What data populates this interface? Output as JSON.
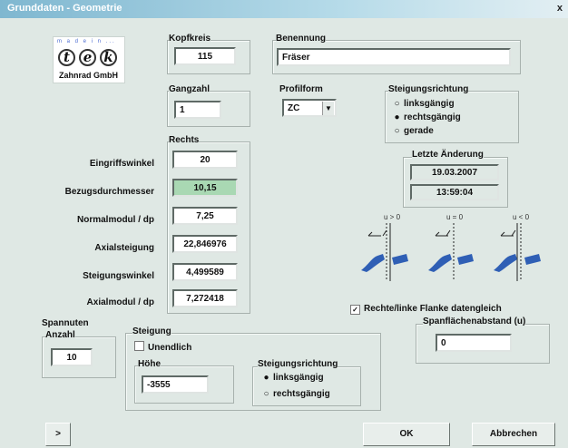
{
  "window": {
    "title": "Grunddaten - Geometrie",
    "close": "x"
  },
  "logo": {
    "top_text": "m a d e i n ...",
    "letters": [
      "t",
      "e",
      "k"
    ],
    "subtitle": "Zahnrad GmbH"
  },
  "kopfkreis": {
    "label": "Kopfkreis",
    "value": "115"
  },
  "benennung": {
    "label": "Benennung",
    "value": "Fräser"
  },
  "gangzahl": {
    "label": "Gangzahl",
    "value": "1"
  },
  "profilform": {
    "label": "Profilform",
    "value": "ZC",
    "arrow": "▼"
  },
  "steigungsrichtung_top": {
    "label": "Steigungsrichtung",
    "options": [
      "linksgängig",
      "rechtsgängig",
      "gerade"
    ],
    "selected": "rechtsgängig"
  },
  "letzte_aenderung": {
    "label": "Letzte Änderung",
    "date": "19.03.2007",
    "time": "13:59:04"
  },
  "rechts": {
    "header": "Rechts",
    "rows": [
      {
        "label": "Eingriffswinkel",
        "value": "20"
      },
      {
        "label": "Bezugsdurchmesser",
        "value": "10,15"
      },
      {
        "label": "Normalmodul / dp",
        "value": "7,25"
      },
      {
        "label": "Axialsteigung",
        "value": "22,846976"
      },
      {
        "label": "Steigungswinkel",
        "value": "4,499589"
      },
      {
        "label": "Axialmodul / dp",
        "value": "7,272418"
      }
    ]
  },
  "diagram": {
    "labels": [
      "u > 0",
      "u = 0",
      "u < 0"
    ]
  },
  "flanke": {
    "label": "Rechte/linke Flanke datengleich",
    "checked": true,
    "mark": "✓"
  },
  "spanflaeche": {
    "label": "Spanflächenabstand (u)",
    "value": "0"
  },
  "spannuten": {
    "label": "Spannuten",
    "anzahl_label": "Anzahl",
    "anzahl_value": "10"
  },
  "steigung": {
    "label": "Steigung",
    "unendlich_label": "Unendlich",
    "unendlich_checked": false,
    "hoehe_label": "Höhe",
    "hoehe_value": "-3555"
  },
  "steigungsrichtung_bottom": {
    "label": "Steigungsrichtung",
    "options": [
      "linksgängig",
      "rechtsgängig"
    ],
    "selected": "linksgängig"
  },
  "buttons": {
    "expand": ">",
    "ok": "OK",
    "cancel": "Abbrechen"
  },
  "colors": {
    "title_bar": "#7fb7d0",
    "dialog_bg": "#dfe8e4",
    "highlight_field": "#a9d8b3",
    "gear_blue": "#2f5fb5",
    "logo_blue": "#4a6ad0"
  }
}
